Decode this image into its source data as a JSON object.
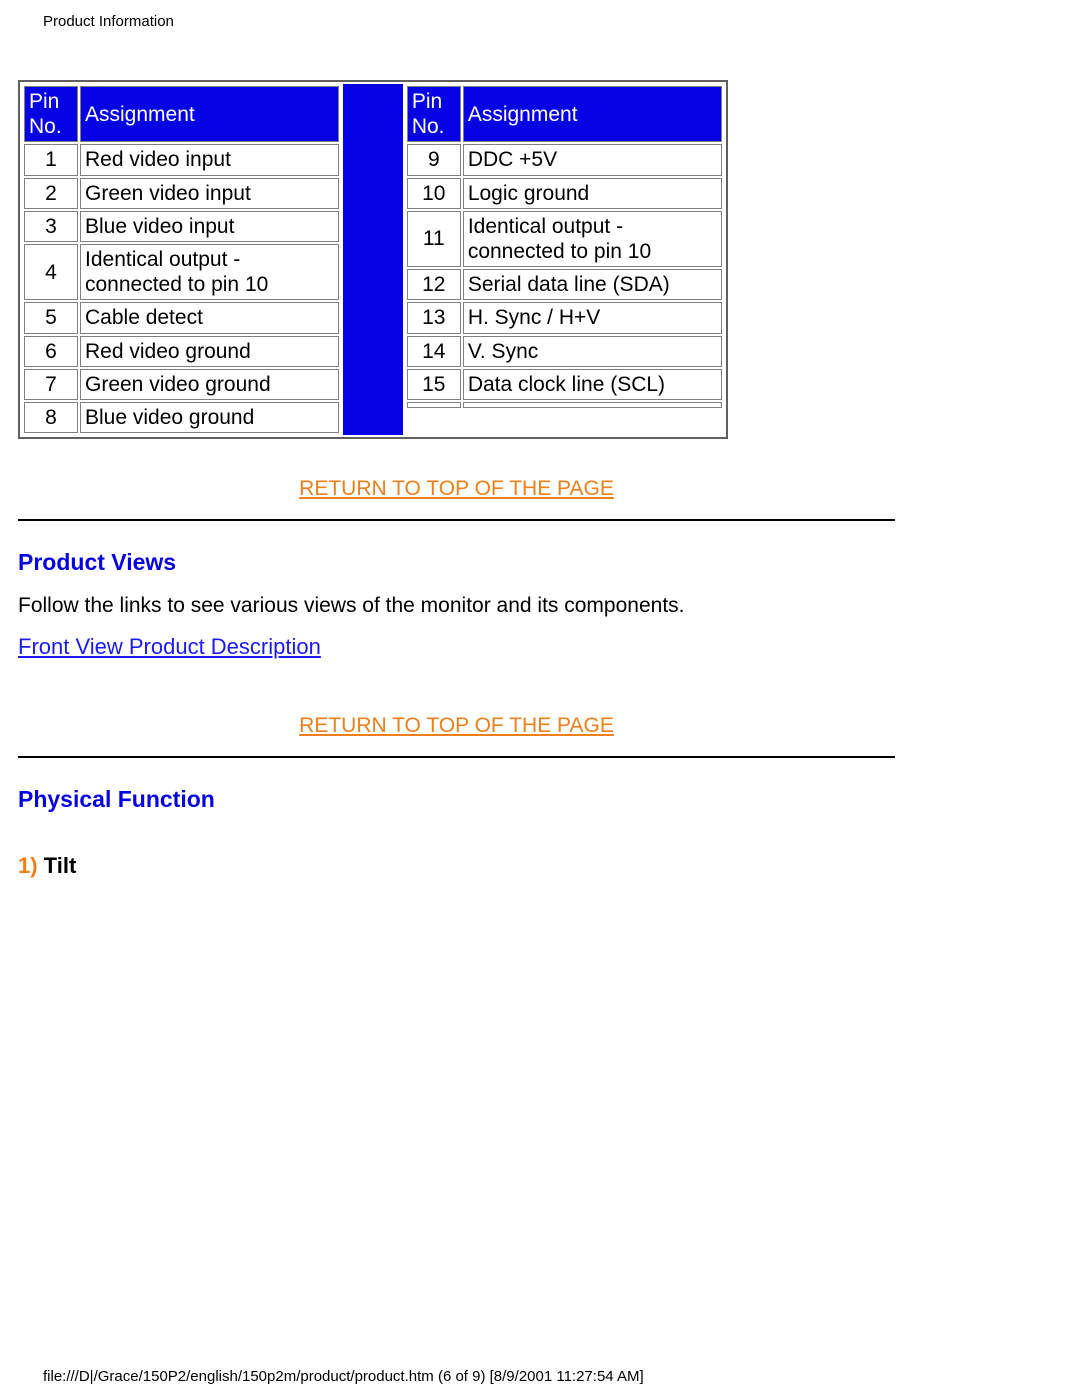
{
  "page": {
    "breadcrumb": "Product Information",
    "footer": "file:///D|/Grace/150P2/english/150p2m/product/product.htm (6 of 9) [8/9/2001 11:27:54 AM]"
  },
  "pin_tables": {
    "left": {
      "headers": {
        "pin": "Pin No.",
        "assign": "Assignment"
      },
      "rows": [
        {
          "pin": "1",
          "assign": "Red video input"
        },
        {
          "pin": "2",
          "assign": "Green video input"
        },
        {
          "pin": "3",
          "assign": "Blue video input"
        },
        {
          "pin": "4",
          "assign": "Identical output - connected to pin 10"
        },
        {
          "pin": "5",
          "assign": "Cable detect"
        },
        {
          "pin": "6",
          "assign": "Red video ground"
        },
        {
          "pin": "7",
          "assign": "Green video ground"
        },
        {
          "pin": "8",
          "assign": "Blue video ground"
        }
      ]
    },
    "right": {
      "headers": {
        "pin": "Pin No.",
        "assign": "Assignment"
      },
      "rows": [
        {
          "pin": "9",
          "assign": "DDC +5V"
        },
        {
          "pin": "10",
          "assign": "Logic ground"
        },
        {
          "pin": "11",
          "assign": "Identical output - connected to pin 10"
        },
        {
          "pin": "12",
          "assign": "Serial data line (SDA)"
        },
        {
          "pin": "13",
          "assign": "H. Sync / H+V"
        },
        {
          "pin": "14",
          "assign": "V. Sync"
        },
        {
          "pin": "15",
          "assign": "Data clock line (SCL)"
        },
        {
          "pin": "",
          "assign": ""
        }
      ]
    }
  },
  "links": {
    "return_top_1": "RETURN TO TOP OF THE PAGE",
    "return_top_2": "RETURN TO TOP OF THE PAGE",
    "front_view": "Front View Product Description"
  },
  "sections": {
    "product_views": {
      "heading": "Product Views",
      "text": "Follow the links to see various views of the monitor and its components."
    },
    "physical_function": {
      "heading": "Physical Function",
      "item1_num": "1)",
      "item1_label": " Tilt"
    }
  }
}
